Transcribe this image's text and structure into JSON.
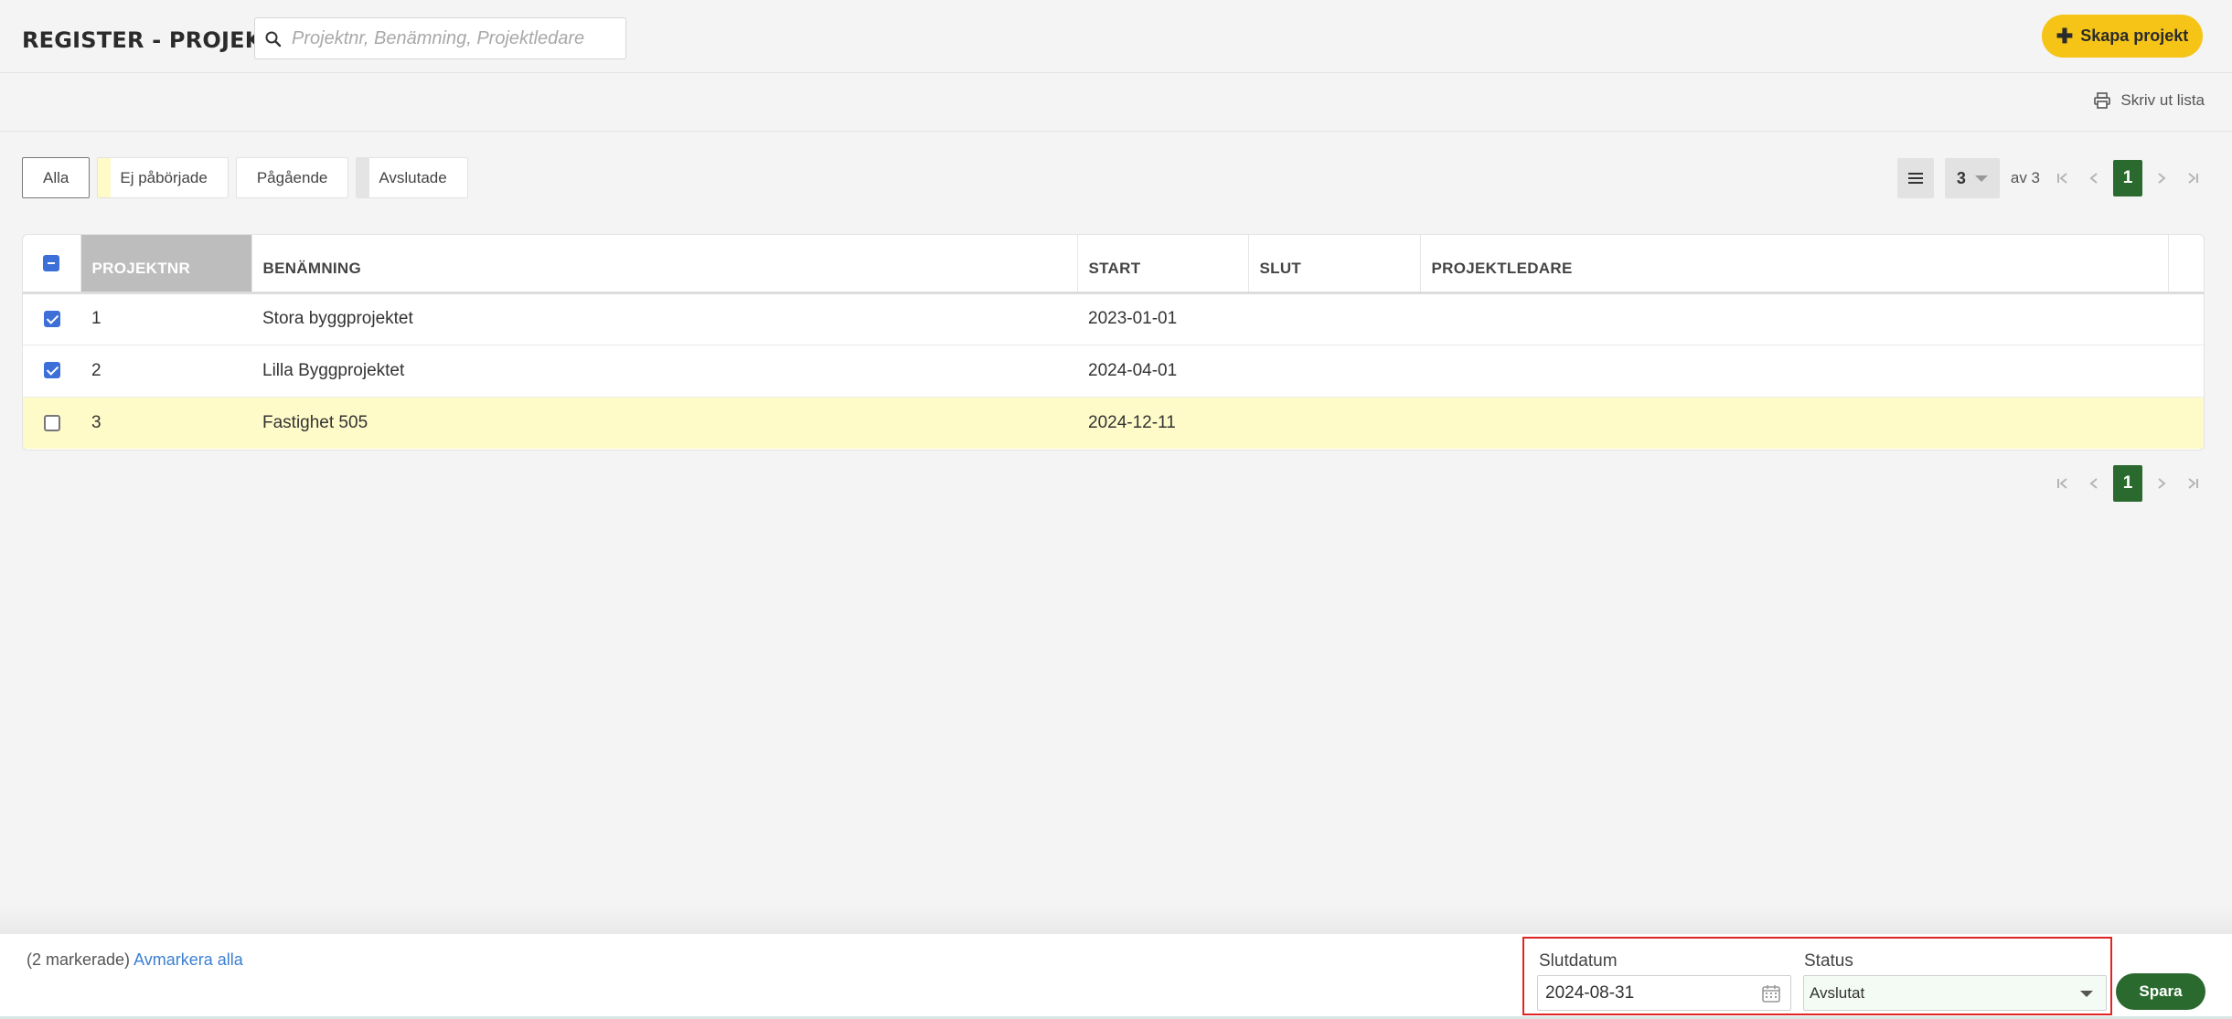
{
  "header": {
    "title": "REGISTER - PROJEKT",
    "search_placeholder": "Projektnr, Benämning, Projektledare",
    "create_label": "Skapa projekt"
  },
  "toolbar": {
    "print_label": "Skriv ut lista"
  },
  "filters": {
    "tabs": [
      {
        "label": "Alla",
        "active": true,
        "swatch": null
      },
      {
        "label": "Ej påbörjade",
        "active": false,
        "swatch": "#fefbc9"
      },
      {
        "label": "Pågående",
        "active": false,
        "swatch": null
      },
      {
        "label": "Avslutade",
        "active": false,
        "swatch": "#e4e4e4"
      }
    ]
  },
  "pagination": {
    "page_size": "3",
    "of_label": "av 3",
    "current_page": "1"
  },
  "table": {
    "columns": [
      "PROJEKTNR",
      "BENÄMNING",
      "START",
      "SLUT",
      "PROJEKTLEDARE"
    ],
    "rows": [
      {
        "checked": true,
        "projektnr": "1",
        "benamning": "Stora byggprojektet",
        "start": "2023-01-01",
        "slut": "",
        "projektledare": "",
        "highlight": false
      },
      {
        "checked": true,
        "projektnr": "2",
        "benamning": "Lilla Byggprojektet",
        "start": "2024-04-01",
        "slut": "",
        "projektledare": "",
        "highlight": false
      },
      {
        "checked": false,
        "projektnr": "3",
        "benamning": "Fastighet 505",
        "start": "2024-12-11",
        "slut": "",
        "projektledare": "",
        "highlight": true
      }
    ]
  },
  "action_bar": {
    "marked_count": "(2 markerade)",
    "unmark_label": "Avmarkera alla",
    "slutdatum_label": "Slutdatum",
    "slutdatum_value": "2024-08-31",
    "status_label": "Status",
    "status_value": "Avslutat",
    "save_label": "Spara"
  },
  "colors": {
    "accent_yellow": "#f6c417",
    "accent_green": "#2b6a2f",
    "checkbox_blue": "#3c6fd8",
    "row_highlight": "#fefbc9",
    "highlight_border": "#e02424"
  }
}
